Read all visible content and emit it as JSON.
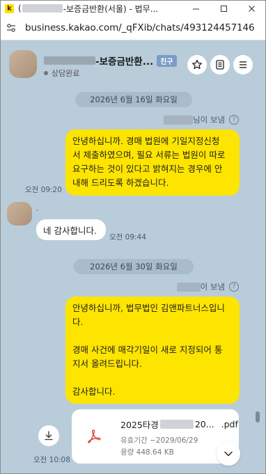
{
  "window": {
    "icon_letter": "k",
    "title_prefix": "(",
    "title_suffix": "-보증금반환(서울) - 법무..."
  },
  "address": {
    "url": "business.kakao.com/_qFXib/chats/493124457146..."
  },
  "header": {
    "room_name_suffix": "-보증금반환...",
    "friend_badge": "친구",
    "status": "상담완료"
  },
  "messages": {
    "date1": "2026년 6월 16일 화요일",
    "sender1_suffix": "님이 보냄",
    "msg1_lines": [
      "안녕하십니까. 경매 법원에 기일지정신청",
      "서 제출하였으며, 필요 서류는 법원이 따로",
      "요구하는 것이 있다고 밝혀지는 경우에 안",
      "내해 드리도록 하겠습니다."
    ],
    "msg1_time": "오전 09:20",
    "reply_name": ".",
    "reply_text": "네 감사합니다.",
    "reply_time": "오전 09:44",
    "date2": "2026년 6월 30일 화요일",
    "sender2_suffix": "이 보냄",
    "msg2_lines": [
      "안녕하십니까, 법무법인 김앤파트너스입니",
      "다.",
      "",
      "경매 사건에 매각기일이 새로 지정되어 통",
      "지서 올려드립니다.",
      "",
      "감사합니다."
    ],
    "file_name_prefix": "2025타경",
    "file_name_mid": "20...",
    "file_ext": ".pdf",
    "file_validity": "유효기간 ~2029/06/29",
    "file_size": "용량 448.64 KB",
    "file_time": "오전 10:08"
  },
  "colors": {
    "me_bubble": "#fee500",
    "chat_bg": "#b9ccda",
    "badge": "#7a9cc6",
    "pdf_icon": "#e0483e"
  },
  "icons": [
    "minimize-icon",
    "maximize-icon",
    "close-icon",
    "site-settings-icon",
    "star-icon",
    "notes-icon",
    "menu-icon",
    "question-icon",
    "download-icon",
    "pdf-icon",
    "chevron-down-icon"
  ]
}
